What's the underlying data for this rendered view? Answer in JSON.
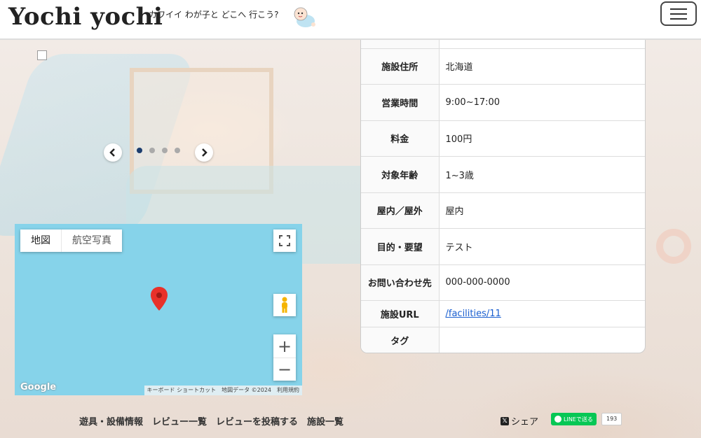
{
  "header": {
    "logo": "Yochi yochi",
    "tagline": "カワイイ わが子と どこへ 行こう?",
    "menu_icon": "hamburger-menu-icon"
  },
  "carousel": {
    "prev_icon": "chevron-left-icon",
    "next_icon": "chevron-right-icon",
    "dot_count": 4,
    "active_index": 0
  },
  "map": {
    "type_map": "地図",
    "type_satellite": "航空写真",
    "google": "Google",
    "footer": [
      "キーボード ショートカット",
      "地図データ ©2024",
      "利用規約"
    ],
    "zoom_in": "+",
    "zoom_out": "−"
  },
  "info": {
    "rows": [
      {
        "label": "施設住所",
        "value": "北海道"
      },
      {
        "label": "営業時間",
        "value": "9:00~17:00"
      },
      {
        "label": "料金",
        "value": "100円"
      },
      {
        "label": "対象年齢",
        "value": "1~3歳"
      },
      {
        "label": "屋内／屋外",
        "value": "屋内"
      },
      {
        "label": "目的・要望",
        "value": "テスト"
      },
      {
        "label": "お問い合わせ先",
        "value": "000-000-0000"
      }
    ],
    "url_label": "施設URL",
    "url_value": "/facilities/11",
    "tag_label": "タグ",
    "tag_value": ""
  },
  "footer": {
    "links": [
      "遊具・設備情報",
      "レビュー一覧",
      "レビューを投稿する",
      "施設一覧"
    ],
    "share_x": "シェア",
    "line_button": "LINEで送る",
    "line_count": "193"
  },
  "colors": {
    "map_water": "#86d3ea",
    "line_green": "#06c755",
    "link_blue": "#1a5fd0",
    "dot_active": "#1c3d6e"
  }
}
